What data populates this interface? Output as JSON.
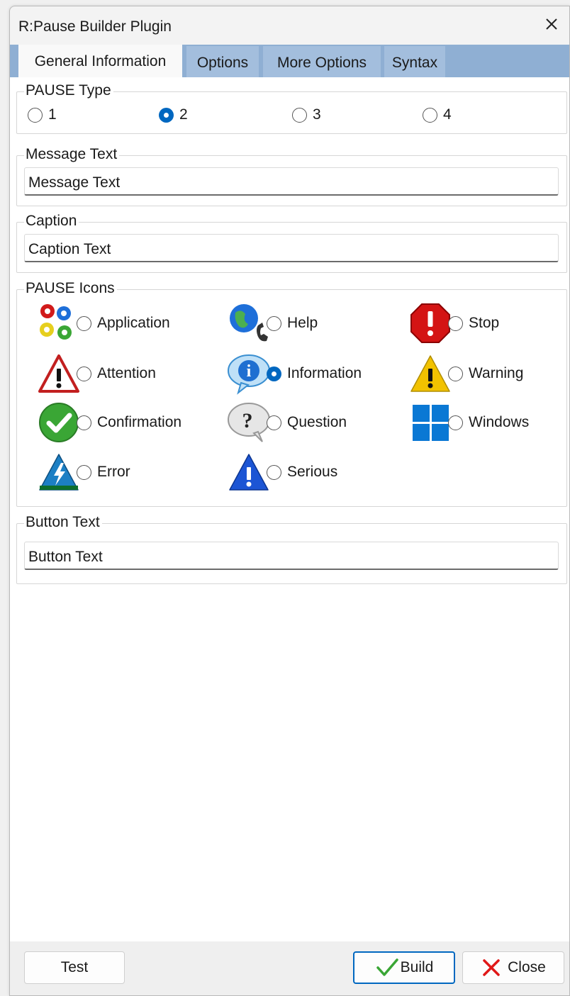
{
  "window": {
    "title": "R:Pause Builder Plugin"
  },
  "tabs": [
    {
      "label": "General Information",
      "active": true
    },
    {
      "label": "Options",
      "active": false
    },
    {
      "label": "More Options",
      "active": false
    },
    {
      "label": "Syntax",
      "active": false
    }
  ],
  "pause_type": {
    "label": "PAUSE Type",
    "options": [
      "1",
      "2",
      "3",
      "4"
    ],
    "selected": "2"
  },
  "message_text": {
    "label": "Message Text",
    "value": "Message Text"
  },
  "caption": {
    "label": "Caption",
    "value": "Caption Text"
  },
  "pause_icons": {
    "label": "PAUSE Icons",
    "selected": "Information",
    "items": [
      {
        "label": "Application",
        "icon": "gears-icon"
      },
      {
        "label": "Help",
        "icon": "globe-phone-icon"
      },
      {
        "label": "Stop",
        "icon": "stop-octagon-icon"
      },
      {
        "label": "Attention",
        "icon": "attention-triangle-icon"
      },
      {
        "label": "Information",
        "icon": "info-bubble-icon"
      },
      {
        "label": "Warning",
        "icon": "warning-triangle-icon"
      },
      {
        "label": "Confirmation",
        "icon": "checkmark-circle-icon"
      },
      {
        "label": "Question",
        "icon": "question-bubble-icon"
      },
      {
        "label": "Windows",
        "icon": "windows-logo-icon"
      },
      {
        "label": "Error",
        "icon": "lightning-icon"
      },
      {
        "label": "Serious",
        "icon": "serious-triangle-icon"
      }
    ]
  },
  "button_text": {
    "label": "Button Text",
    "value": "Button Text"
  },
  "footer": {
    "test_label": "Test",
    "build_label": "Build",
    "close_label": "Close"
  },
  "colors": {
    "accent": "#0067c0",
    "tab_bar": "#8fafd3",
    "stop_red": "#d41414",
    "warning_yellow": "#f2c200",
    "confirm_green": "#3aa635",
    "windows_blue": "#0a78d4"
  }
}
